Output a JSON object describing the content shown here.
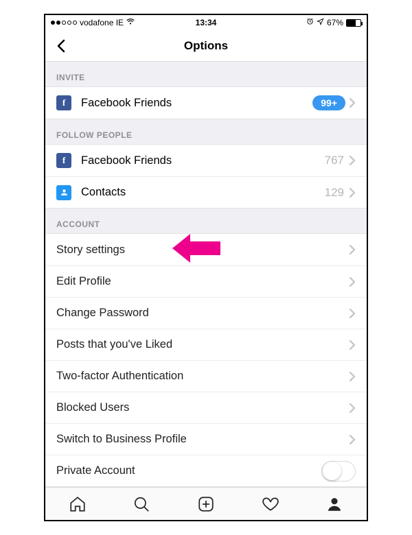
{
  "statusbar": {
    "carrier": "vodafone IE",
    "time": "13:34",
    "battery_pct": "67%"
  },
  "header": {
    "title": "Options"
  },
  "sections": {
    "invite": {
      "header": "INVITE",
      "fb_label": "Facebook Friends",
      "fb_badge": "99+"
    },
    "follow": {
      "header": "FOLLOW PEOPLE",
      "fb_label": "Facebook Friends",
      "fb_count": "767",
      "contacts_label": "Contacts",
      "contacts_count": "129"
    },
    "account": {
      "header": "ACCOUNT",
      "items": [
        "Story settings",
        "Edit Profile",
        "Change Password",
        "Posts that you've Liked",
        "Two-factor Authentication",
        "Blocked Users",
        "Switch to Business Profile",
        "Private Account"
      ]
    }
  }
}
